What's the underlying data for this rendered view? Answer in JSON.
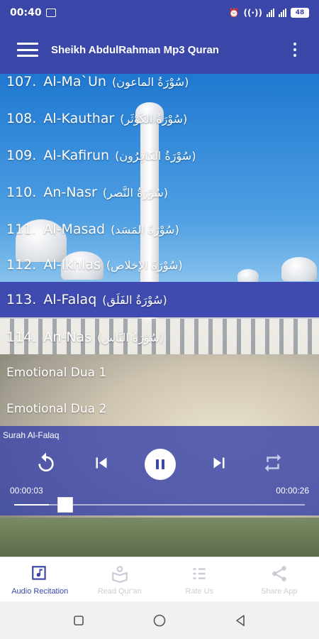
{
  "status_bar": {
    "time": "00:40",
    "battery": "48"
  },
  "app_bar": {
    "title": "Sheikh AbdulRahman Mp3 Quran"
  },
  "list": {
    "items": [
      {
        "num": "107.",
        "name": "Al-Ma`Un",
        "arabic": "(سُوْرَةُ الماعون)"
      },
      {
        "num": "108.",
        "name": "Al-Kauthar",
        "arabic": "(سُوْرَةُ الكَوْثَر)"
      },
      {
        "num": "109.",
        "name": "Al-Kafirun",
        "arabic": "(سُوْرَةُ الكافِرُون)"
      },
      {
        "num": "110.",
        "name": "An-Nasr",
        "arabic": "(سُوْرَةُ النَّصر)"
      },
      {
        "num": "111.",
        "name": "Al-Masad",
        "arabic": "(سُوْرَةُ المَسَد)"
      },
      {
        "num": "112.",
        "name": "Al-Ikhlas",
        "arabic": "(سُوْرَةُ الإخلاص)"
      },
      {
        "num": "113.",
        "name": "Al-Falaq",
        "arabic": "(سُوْرَةُ الفَلَق)"
      },
      {
        "num": "114.",
        "name": "An-Nas",
        "arabic": "(سُوْرَةُ النَّاس)"
      }
    ],
    "extra_items": [
      "Emotional Dua 1",
      "Emotional Dua 2"
    ],
    "selected_index": 6
  },
  "player": {
    "track": "Surah Al-Falaq",
    "elapsed": "00:00:03",
    "duration": "00:00:26",
    "progress_fraction": 0.12
  },
  "bottom_nav": {
    "items": [
      {
        "label": "Audio Recitation",
        "icon": "music-note-icon",
        "active": true
      },
      {
        "label": "Read Qur'an",
        "icon": "book-reader-icon",
        "active": false
      },
      {
        "label": "Rate Us",
        "icon": "rate-list-icon",
        "active": false
      },
      {
        "label": "Share App",
        "icon": "share-icon",
        "active": false
      }
    ]
  },
  "colors": {
    "primary": "#3a46a8",
    "selected_row": "#3f4bb0",
    "inactive_nav": "#c9ced6"
  }
}
